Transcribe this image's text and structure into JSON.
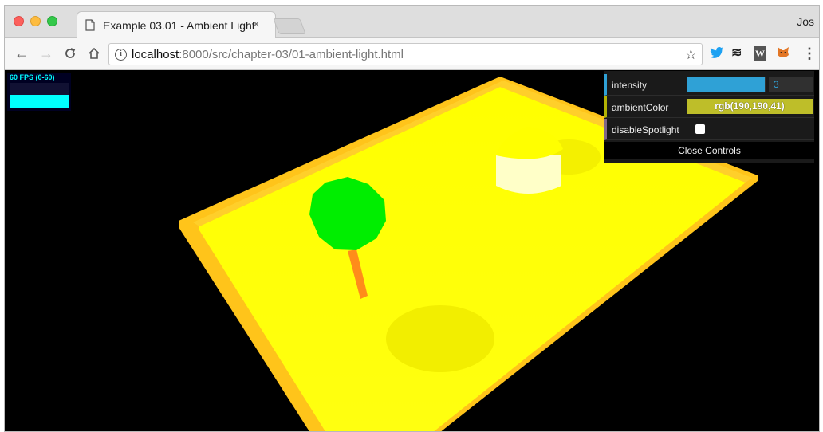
{
  "browser": {
    "tab_title": "Example 03.01 - Ambient Light",
    "tab_close": "×",
    "profile_name": "Jos",
    "url_host": "localhost",
    "url_rest": ":8000/src/chapter-03/01-ambient-light.html",
    "nav": {
      "back": "←",
      "forward": "→",
      "reload": "C",
      "home": "⌂"
    },
    "star_icon": "☆",
    "info_icon": "i",
    "extensions": {
      "twitter": "🐦",
      "buffer": "≋",
      "w": "W",
      "metamask": "🦊",
      "menu": "⋮"
    }
  },
  "stats": {
    "label": "60 FPS (0-60)"
  },
  "controls": {
    "intensity": {
      "label": "intensity",
      "value": "3",
      "fraction": 0.98
    },
    "ambient_color": {
      "label": "ambientColor",
      "value": "rgb(190,190,41)",
      "color": "#bebe29"
    },
    "disable_spotlight": {
      "label": "disableSpotlight",
      "checked": false
    },
    "close_label": "Close Controls"
  },
  "colors": {
    "plane": "#ffff00",
    "border": "#ffc41a",
    "sphere": "#00ee00",
    "trunk": "#ff8c1a",
    "cylinder": "#ffffc8"
  }
}
